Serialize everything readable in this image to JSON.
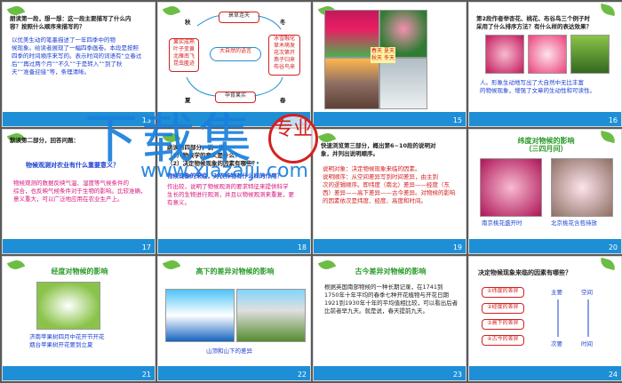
{
  "slides": [
    {
      "num": "13",
      "lines": [
        "朗读第一段，想一想：这一段主要描写了什么内",
        "容？按照什么顺序来描写的？"
      ],
      "body": [
        "以优美生动的笔墨描述了一年四季中的物",
        "候现象。给读者展现了一幅四季画卷。本段是按照",
        "四季的时间顺序来写的。表示时间的词语有“立春过",
        "后”“再过两个月”“不久”“于是转入”“到了秋",
        "天”“准备迎接”等，条理清晰。"
      ]
    },
    {
      "num": "14",
      "season_top": "秋",
      "season_top_right": "冬",
      "season_left": "夏",
      "season_right": "春",
      "box_top": "衰草连天",
      "box_left": [
        "果实成熟",
        "叶子变黄",
        "北雁南飞",
        "昆虫匿迹"
      ],
      "box_center": "大自然的语言",
      "box_right": [
        "冰雪融化",
        "草木萌发",
        "花次第开",
        "燕子归来",
        "布谷鸟来"
      ],
      "box_bottom": "孕育果实"
    },
    {
      "num": "15",
      "labels": [
        "春天",
        "夏天",
        "秋天",
        "冬天"
      ]
    },
    {
      "num": "16",
      "lines": [
        "第2段作者举杏花、桃花、布谷鸟三个例子时",
        "采用了什么排序方法？有什么样的表达效果？"
      ],
      "answer": [
        "人。形象生动地写出了大自然中无比丰富",
        "的物候现象，增强了文章的生动性和可读性。"
      ]
    },
    {
      "num": "17",
      "lines": [
        "默读第二部分，回答问题："
      ],
      "question": "物候观测对农业有什么重要意义？",
      "answer": [
        "物候观测的数据反映气温、湿度等气候条件的",
        "综合，也反映气候条件对于生物的影响。比较准确，",
        "意义重大，可以广泛地应用在农业生产上。"
      ]
    },
    {
      "num": "18",
      "lines": [
        "跳读第四部分，说一说：",
        "（1）物候学的意义是什么？",
        "（2）决定物候现象的因素有哪些？"
      ],
      "question": "物候现象的来临，对农作物有什么样的作用？",
      "answer": [
        "作出较，说明了物候观测的要求特征来提供科学",
        "生长的生物进行观测，并且以物候观测来重复，更",
        "有意义。"
      ]
    },
    {
      "num": "19",
      "lines": [
        "快速浏览第三部分，概出第6~10段的说明对",
        "象，并列出说明顺序。"
      ],
      "items": [
        "说明对象：决定物候现象来临的因素。",
        "说明顺序：从空间差异写到时间差异，由主到",
        "次的逻辑顺序。即纬度（南北）差异——经度（东",
        "西）差异——高下差异——古今差异。对物候的影响",
        "的因素依次是纬度、经度、高度和时间。"
      ]
    },
    {
      "num": "20",
      "title": "纬度对物候的影响",
      "subtitle": "（三四月间）",
      "captions": [
        "南京桃花盛开时",
        "北京桃花含苞待放"
      ]
    },
    {
      "num": "21",
      "title": "经度对物候的影响",
      "caption": [
        "济南苹果树四月中花开节开花",
        "烟台苹果树开花要到立夏"
      ]
    },
    {
      "num": "22",
      "title": "高下的差异对物候的影响",
      "caption": "山顶和山下的差异"
    },
    {
      "num": "23",
      "title": "古今差异对物候的影响",
      "body": [
        "根据英国南部物候的一种长期记录，在1741到",
        "1750年十年平均的春季七种开花植物与开花日期",
        "1921到1930年十年的平均值相比较，可以看出后者",
        "比前者早九天。就是说，春天提前九天。"
      ]
    },
    {
      "num": "24",
      "title": "决定物候现象来临的因素有哪些？",
      "factors": [
        "①纬度的差异",
        "②经度的差异",
        "③高下的差异",
        "④古今的差异"
      ],
      "col_labels": [
        "主要",
        "空间"
      ],
      "bottom_labels": [
        "次要",
        "时间"
      ]
    }
  ],
  "watermark": {
    "main": "下载集",
    "url": "www.xiazaiji.com",
    "badge": "专业"
  },
  "colors": {
    "header_bar": "#1e8fd6",
    "leaf": "#6cbd45",
    "accent_red": "#d42020",
    "accent_blue": "#1b3fd0"
  }
}
